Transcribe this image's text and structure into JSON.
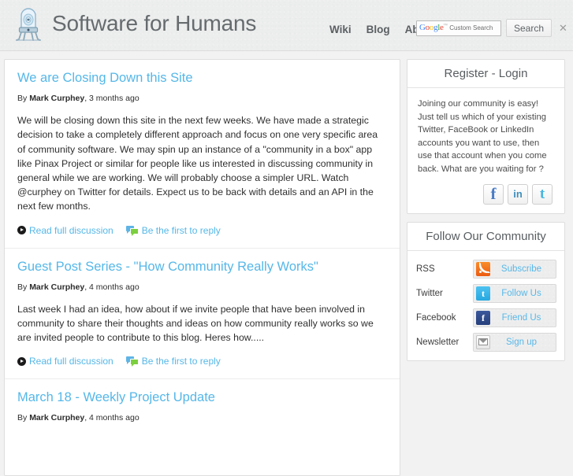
{
  "header": {
    "brand_title": "Software for Humans",
    "logo_icon": "robot-rocket-icon",
    "nav": [
      {
        "label": "Wiki"
      },
      {
        "label": "Blog"
      },
      {
        "label": "About"
      }
    ],
    "search": {
      "brand_mark": "Google",
      "trademark": "™",
      "placeholder": "Custom Search",
      "value": "",
      "button_label": "Search",
      "close_label": "✕"
    }
  },
  "main": {
    "posts": [
      {
        "title": "We are Closing Down this Site",
        "by_prefix": "By",
        "author": "Mark Curphey",
        "timestamp": ", 3 months ago",
        "body": "We will be closing down this site in the next few weeks. We have made a strategic decision to take a completely different approach and focus on one very specific area of community software. We may spin up an instance of a \"community in a box\" app like Pinax Project or similar for people like us interested in discussing community in general while we are working. We will probably choose a simpler URL. Watch @curphey on Twitter for details. Expect us to be back with details and an API in the next few months.",
        "read_label": "Read full discussion",
        "reply_label": "Be the first to reply"
      },
      {
        "title": "Guest Post Series - \"How Community Really Works\"",
        "by_prefix": "By",
        "author": "Mark Curphey",
        "timestamp": ", 4 months ago",
        "body": "Last week I had an idea, how about if we invite people that have been involved in community to share their thoughts and ideas on how community really works so we are invited people to contribute to this blog. Heres how.....",
        "read_label": "Read full discussion",
        "reply_label": "Be the first to reply"
      },
      {
        "title": "March 18 - Weekly Project Update",
        "by_prefix": "By",
        "author": "Mark Curphey",
        "timestamp": ", 4 months ago",
        "body": "",
        "read_label": "",
        "reply_label": ""
      }
    ]
  },
  "sidebar": {
    "register": {
      "header": "Register - Login",
      "text": "Joining our community is easy! Just tell us which of your existing Twitter, FaceBook or LinkedIn accounts you want to use, then use that account when you come back. What are you waiting for ?",
      "social": [
        {
          "name": "facebook",
          "glyph": "f"
        },
        {
          "name": "linkedin",
          "glyph": "in"
        },
        {
          "name": "twitter",
          "glyph": "t"
        }
      ]
    },
    "follow": {
      "header": "Follow Our Community",
      "rows": [
        {
          "name": "RSS",
          "icon": "rss-icon",
          "button_label": "Subscribe"
        },
        {
          "name": "Twitter",
          "icon": "twitter-icon",
          "button_label": "Follow Us"
        },
        {
          "name": "Facebook",
          "icon": "facebook-icon",
          "button_label": "Friend Us"
        },
        {
          "name": "Newsletter",
          "icon": "mail-icon",
          "button_label": "Sign up"
        }
      ]
    }
  },
  "colors": {
    "link": "#55b7e8",
    "header_bg": "#eceded",
    "panel_bg": "#ffffff",
    "border": "#dedede",
    "text": "#2f2f2f"
  }
}
